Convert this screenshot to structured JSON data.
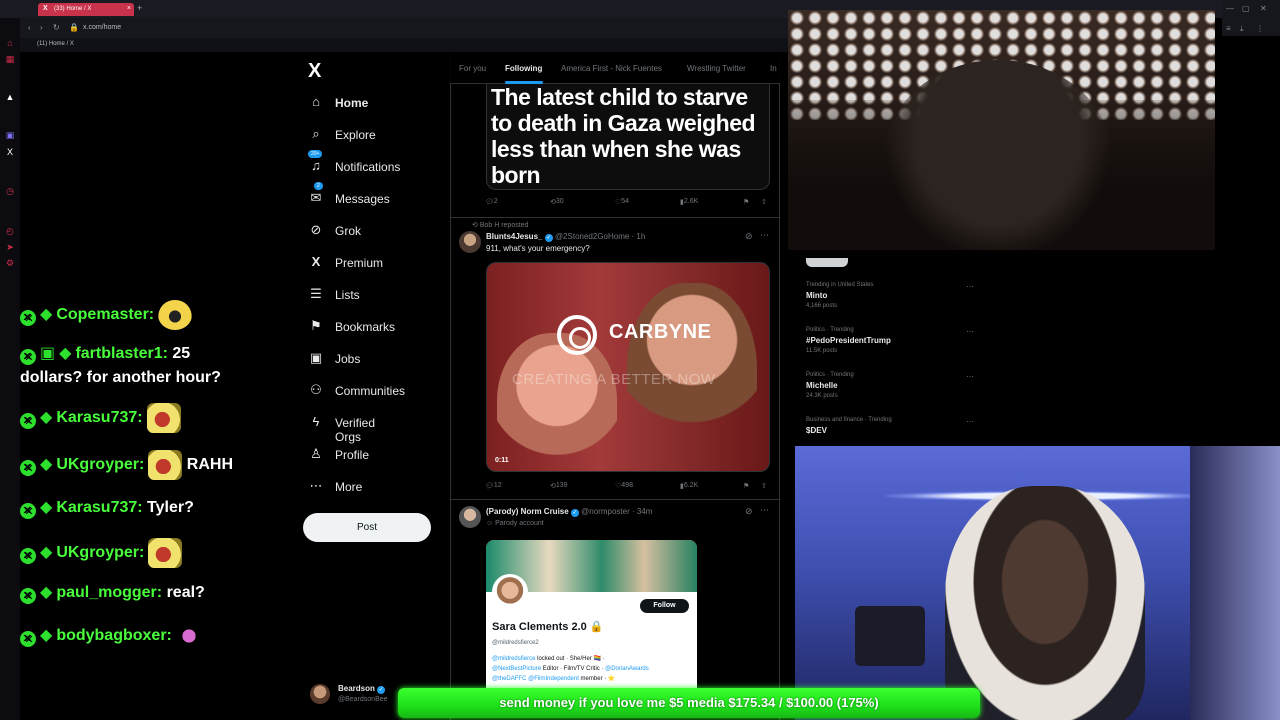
{
  "browser": {
    "tab_title": "(33) Home / X",
    "new_tab": "+",
    "url": "x.com/home",
    "bookmark": "(11) Home / X",
    "tab_close": "×"
  },
  "chat": {
    "messages": [
      {
        "user": "Copemaster:",
        "text": ""
      },
      {
        "user": "fartblaster1:",
        "text": "25"
      },
      {
        "user": "",
        "text": "dollars? for another hour?"
      },
      {
        "user": "Karasu737:",
        "text": ""
      },
      {
        "user": "UKgroyper:",
        "text": "RAHH"
      },
      {
        "user": "Karasu737:",
        "text": "Tyler?"
      },
      {
        "user": "UKgroyper:",
        "text": ""
      },
      {
        "user": "paul_mogger:",
        "text": "real?"
      },
      {
        "user": "bodybagboxer:",
        "text": ""
      }
    ]
  },
  "x_nav": {
    "logo": "X",
    "items": [
      {
        "label": "Home",
        "icon": "home-icon",
        "glyph": "⌂"
      },
      {
        "label": "Explore",
        "icon": "search-icon",
        "glyph": "⌕"
      },
      {
        "label": "Notifications",
        "icon": "bell-icon",
        "glyph": "🔔",
        "badge": "20+"
      },
      {
        "label": "Messages",
        "icon": "mail-icon",
        "glyph": "✉",
        "badge": "2"
      },
      {
        "label": "Grok",
        "icon": "grok-icon",
        "glyph": "⊘"
      },
      {
        "label": "Premium",
        "icon": "x-icon",
        "glyph": "X"
      },
      {
        "label": "Lists",
        "icon": "list-icon",
        "glyph": "☰"
      },
      {
        "label": "Bookmarks",
        "icon": "bookmark-icon",
        "glyph": "⚑"
      },
      {
        "label": "Jobs",
        "icon": "briefcase-icon",
        "glyph": "▣"
      },
      {
        "label": "Communities",
        "icon": "people-icon",
        "glyph": "⚇"
      },
      {
        "label": "Verified Orgs",
        "icon": "lightning-icon",
        "glyph": "ϟ"
      },
      {
        "label": "Profile",
        "icon": "person-icon",
        "glyph": "♙"
      },
      {
        "label": "More",
        "icon": "more-icon",
        "glyph": "⋯"
      }
    ],
    "post_label": "Post",
    "account": {
      "name": "Beardson",
      "handle": "@BeardsonBee"
    }
  },
  "feed": {
    "tabs": [
      "For you",
      "Following",
      "America First - Nick Fuentes",
      "Wrestling Twitter",
      "In"
    ],
    "tweet1": {
      "image_text": "The latest child to starve to death in Gaza weighed less than when she was born",
      "stats": {
        "replies": "2",
        "reposts": "30",
        "likes": "54",
        "views": "2.6K"
      }
    },
    "tweet2": {
      "repost_by": "Bob H reposted",
      "name": "Blunts4Jesus_",
      "handle": "@2Stoned2GoHome · 1h",
      "body": "911, what's your emergency?",
      "video": {
        "brand": "CARBYNE",
        "tagline": "CREATING A BETTER NOW",
        "duration": "0:11"
      },
      "stats": {
        "replies": "12",
        "reposts": "139",
        "likes": "498",
        "views": "6.2K"
      }
    },
    "tweet3": {
      "name": "(Parody) Norm Cruise",
      "handle": "@normposter · 34m",
      "label": "Parody account",
      "card": {
        "name": "Sara Clements 2.0 🔒",
        "handle": "@mildredsfierce2",
        "follow": "Follow",
        "bio_1": "@mildredsfierce",
        "bio_2": " locked out · She/Her 🏳️‍🌈 ·",
        "bio_3": "@NextBestPicture",
        "bio_4": " Editor · Film/TV Critic · ",
        "bio_5": "@DorianAwards",
        "bio_6": "@theDAFFC @FilmIndependent",
        "bio_7": " member · ⭐"
      }
    }
  },
  "trending": [
    {
      "category": "Trending in United States",
      "title": "Minto",
      "count": "4,166 posts"
    },
    {
      "category": "Politics · Trending",
      "title": "#PedoPresidentTrump",
      "count": "11.5K posts"
    },
    {
      "category": "Politics · Trending",
      "title": "Michelle",
      "count": "24.3K posts"
    },
    {
      "category": "Business and finance · Trending",
      "title": "$DEV",
      "count": ""
    }
  ],
  "donation": {
    "text": "send money if you love me $5 media $175.34 / $100.00 (175%)"
  },
  "colors": {
    "accent": "#1d9bf0",
    "chat_user": "#49ff3b",
    "donation": "#1ee01a",
    "opera_red": "#d02c4a"
  }
}
